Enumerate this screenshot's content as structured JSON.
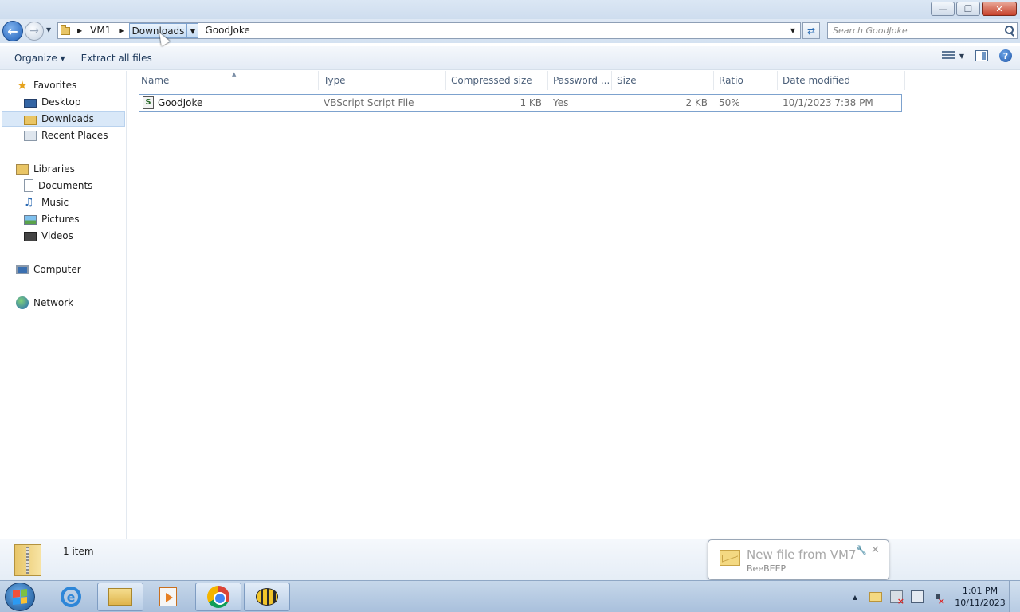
{
  "window": {
    "controls": {
      "minimize": "—",
      "maximize": "❐",
      "close": "✕"
    }
  },
  "navigation": {
    "breadcrumbs": [
      "VM1",
      "Downloads",
      "GoodJoke"
    ],
    "active_crumb": "Downloads",
    "search_placeholder": "Search GoodJoke"
  },
  "toolbar": {
    "organize_label": "Organize",
    "extract_label": "Extract all files"
  },
  "navpane": {
    "favorites": {
      "label": "Favorites",
      "items": [
        "Desktop",
        "Downloads",
        "Recent Places"
      ]
    },
    "libraries": {
      "label": "Libraries",
      "items": [
        "Documents",
        "Music",
        "Pictures",
        "Videos"
      ]
    },
    "computer": "Computer",
    "network": "Network",
    "selected": "Downloads"
  },
  "columns": [
    "Name",
    "Type",
    "Compressed size",
    "Password ...",
    "Size",
    "Ratio",
    "Date modified"
  ],
  "files": [
    {
      "name": "GoodJoke",
      "type": "VBScript Script File",
      "compressed_size": "1 KB",
      "password": "Yes",
      "size": "2 KB",
      "ratio": "50%",
      "date_modified": "10/1/2023 7:38 PM",
      "icon": "vbscript-file-icon"
    }
  ],
  "details": {
    "item_count": "1 item"
  },
  "notification": {
    "title": "New file from VM7",
    "app": "BeeBEEP"
  },
  "taskbar": {
    "apps": [
      "internet-explorer",
      "windows-explorer",
      "media-player",
      "chrome",
      "beebeep"
    ],
    "clock_time": "1:01 PM",
    "clock_date": "10/11/2023"
  }
}
